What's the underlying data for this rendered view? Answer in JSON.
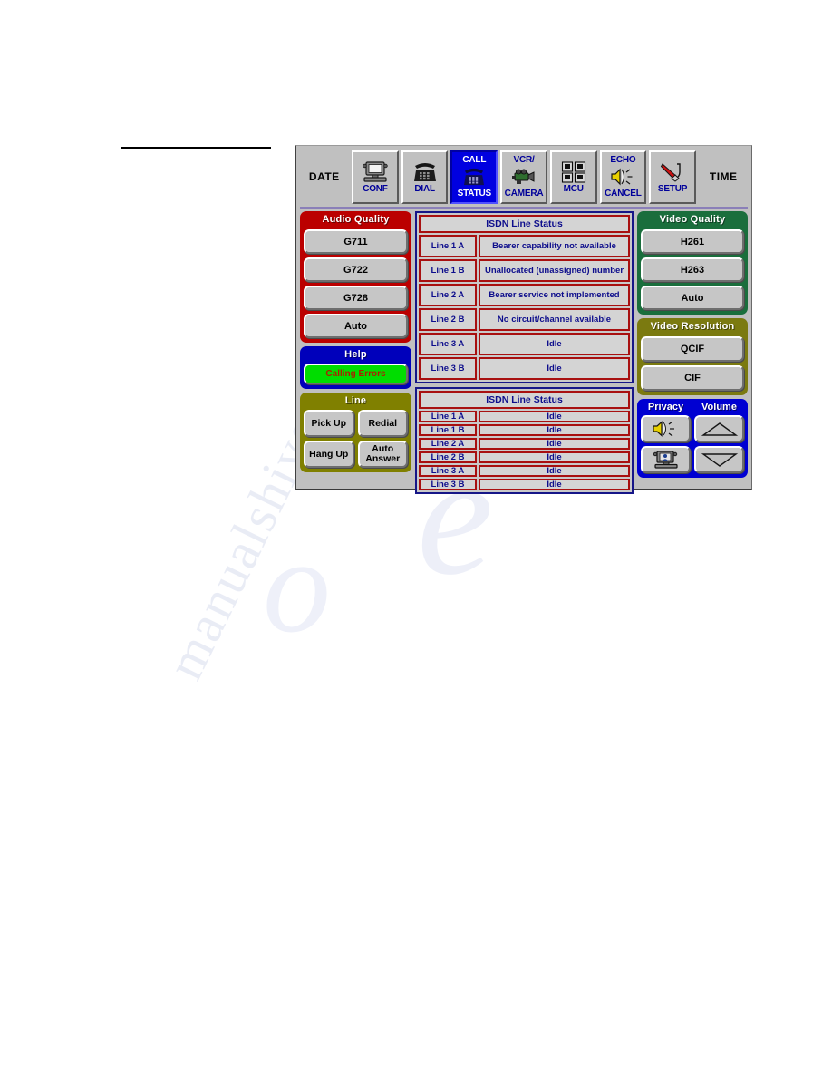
{
  "device": {
    "toolbar": {
      "date_label": "DATE",
      "time_label": "TIME",
      "buttons": [
        {
          "top": "",
          "bottom": "CONF",
          "icon": "monitor-icon",
          "active": false
        },
        {
          "top": "",
          "bottom": "DIAL",
          "icon": "telephone-icon",
          "active": false
        },
        {
          "top": "CALL",
          "bottom": "STATUS",
          "icon": "telephone-icon",
          "active": true
        },
        {
          "top": "VCR/",
          "bottom": "CAMERA",
          "icon": "camcorder-icon",
          "active": false
        },
        {
          "top": "",
          "bottom": "MCU",
          "icon": "multi-screen-icon",
          "active": false
        },
        {
          "top": "ECHO",
          "bottom": "CANCEL",
          "icon": "speaker-icon",
          "active": false
        },
        {
          "top": "",
          "bottom": "SETUP",
          "icon": "tools-icon",
          "active": false
        }
      ]
    },
    "audio_quality": {
      "title": "Audio Quality",
      "options": [
        "G711",
        "G722",
        "G728",
        "Auto"
      ]
    },
    "help": {
      "title": "Help",
      "button": "Calling Errors"
    },
    "line": {
      "title": "Line",
      "buttons": [
        "Pick Up",
        "Redial",
        "Hang Up",
        "Auto Answer"
      ]
    },
    "isdn_primary": {
      "title": "ISDN Line Status",
      "rows": [
        {
          "line": "Line 1 A",
          "status": "Bearer capability not available"
        },
        {
          "line": "Line 1 B",
          "status": "Unallocated (unassigned) number"
        },
        {
          "line": "Line 2 A",
          "status": "Bearer service not implemented"
        },
        {
          "line": "Line 2 B",
          "status": "No circuit/channel available"
        },
        {
          "line": "Line 3 A",
          "status": "Idle"
        },
        {
          "line": "Line 3 B",
          "status": "Idle"
        }
      ]
    },
    "isdn_secondary": {
      "title": "ISDN Line Status",
      "rows": [
        {
          "line": "Line 1 A",
          "status": "Idle"
        },
        {
          "line": "Line 1 B",
          "status": "Idle"
        },
        {
          "line": "Line 2 A",
          "status": "Idle"
        },
        {
          "line": "Line 2 B",
          "status": "Idle"
        },
        {
          "line": "Line 3 A",
          "status": "Idle"
        },
        {
          "line": "Line 3 B",
          "status": "Idle"
        }
      ]
    },
    "video_quality": {
      "title": "Video Quality",
      "options": [
        "H261",
        "H263",
        "Auto"
      ]
    },
    "video_resolution": {
      "title": "Video Resolution",
      "options": [
        "QCIF",
        "CIF"
      ]
    },
    "privacy_volume": {
      "privacy_label": "Privacy",
      "volume_label": "Volume",
      "buttons": [
        {
          "icon": "speaker-mute-icon"
        },
        {
          "icon": "volume-up-icon"
        },
        {
          "icon": "camera-privacy-icon"
        },
        {
          "icon": "volume-down-icon"
        }
      ]
    },
    "colors": {
      "audio_quality_bg": "#bb0000",
      "help_bg": "#0000bb",
      "line_bg": "#808000",
      "video_quality_bg": "#1a6e3c",
      "video_resolution_bg": "#7b7a10",
      "privacy_volume_bg": "#0000d2",
      "active_button_bg": "#0000e0",
      "help_button_bg": "#00dd00",
      "panel_bg": "#c0c0c0",
      "table_text": "#0d0d8c",
      "table_border": "#a81010"
    }
  },
  "watermark": {
    "line1": "manualshive.com",
    "line2": "e",
    "line3": "o"
  }
}
